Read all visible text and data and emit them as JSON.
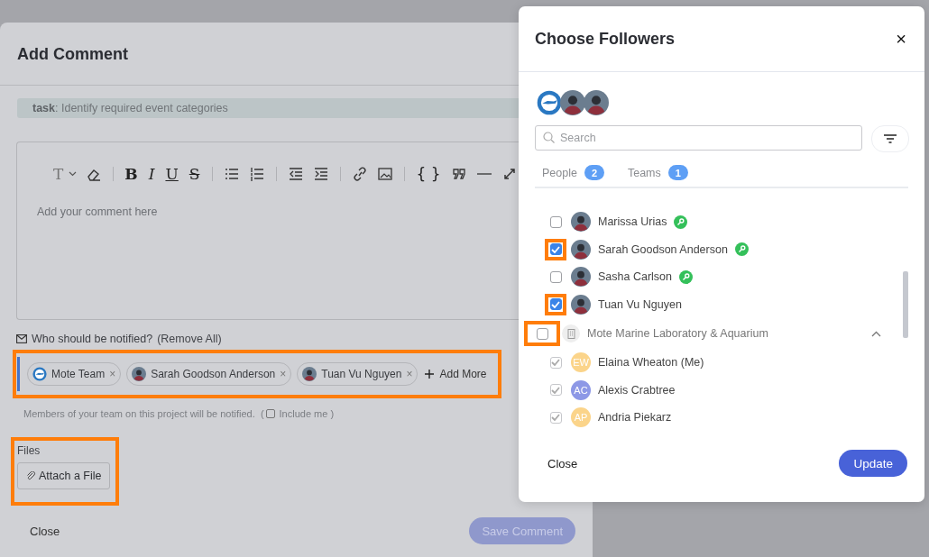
{
  "add_comment": {
    "title": "Add Comment",
    "task_label": "task",
    "task_text": ": Identify required event categories",
    "toolbar": [
      {
        "kind": "text-style",
        "glyph": "T"
      },
      {
        "kind": "eraser"
      },
      {
        "kind": "sep"
      },
      {
        "kind": "bold",
        "glyph": "B"
      },
      {
        "kind": "italic",
        "glyph": "I"
      },
      {
        "kind": "underline",
        "glyph": "U"
      },
      {
        "kind": "strike",
        "glyph": "S"
      },
      {
        "kind": "sep"
      },
      {
        "kind": "bullets"
      },
      {
        "kind": "numbers"
      },
      {
        "kind": "sep"
      },
      {
        "kind": "outdent"
      },
      {
        "kind": "indent"
      },
      {
        "kind": "sep"
      },
      {
        "kind": "link"
      },
      {
        "kind": "image"
      },
      {
        "kind": "sep"
      },
      {
        "kind": "code",
        "glyph": "{ }"
      },
      {
        "kind": "quote"
      },
      {
        "kind": "rule"
      },
      {
        "kind": "expand"
      }
    ],
    "placeholder": "Add your comment here",
    "notify_label": "Who should be notified?",
    "remove_all": "(Remove All)",
    "chips": [
      {
        "kind": "team",
        "label": "Mote Team",
        "remove": "×"
      },
      {
        "kind": "person",
        "label": "Sarah Goodson Anderson",
        "remove": "×"
      },
      {
        "kind": "person",
        "label": "Tuan Vu Nguyen",
        "remove": "×"
      }
    ],
    "add_more": "Add More",
    "note": "Members of your team on this project will be notified.  (",
    "include_me": {
      "label": "Include me )",
      "checked": false
    },
    "files_label": "Files",
    "attach": "Attach a File",
    "close": "Close",
    "save": {
      "label": "Save Comment",
      "disabled": true
    }
  },
  "followers": {
    "title": "Choose Followers",
    "close": "×",
    "search": {
      "placeholder": "Search"
    },
    "tabs": [
      {
        "label": "People",
        "count": "2",
        "selected": false
      },
      {
        "label": "Teams",
        "count": "1",
        "selected": false
      }
    ],
    "people": [
      {
        "name": "Marissa Urias",
        "checked": false,
        "key": true
      },
      {
        "name": "Sarah Goodson Anderson",
        "checked": true,
        "key": true
      },
      {
        "name": "Sasha Carlson",
        "checked": false,
        "key": true
      },
      {
        "name": "Tuan Vu Nguyen",
        "checked": true,
        "key": false
      }
    ],
    "group": {
      "name": "Mote Marine Laboratory & Aquarium",
      "checked": false,
      "expanded": true,
      "members": [
        {
          "name": "Elaina Wheaton (Me)",
          "initials": "EW",
          "color": "#fbd48a",
          "checked": true,
          "disabled": true
        },
        {
          "name": "Alexis Crabtree",
          "initials": "AC",
          "color": "#8d98e6",
          "checked": true,
          "disabled": true
        },
        {
          "name": "Andria Piekarz",
          "initials": "AP",
          "color": "#fbd48a",
          "checked": true,
          "disabled": true
        }
      ]
    },
    "footer_close": "Close",
    "update": "Update"
  }
}
